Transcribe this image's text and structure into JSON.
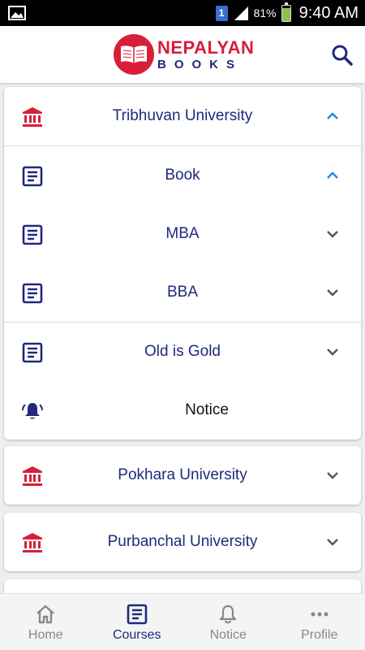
{
  "status_bar": {
    "sim_slot": "1",
    "battery": "81%",
    "time": "9:40 AM"
  },
  "header": {
    "logo_line1": "NEPALYAN",
    "logo_line2": "BOOKS"
  },
  "colors": {
    "brand_red": "#d71f3a",
    "brand_navy": "#1f2a7c",
    "accent_blue": "#1e88e5"
  },
  "universities": [
    {
      "name": "Tribhuvan University",
      "expanded": true,
      "children": [
        {
          "label": "Book",
          "expanded": true
        },
        {
          "label": "MBA",
          "expanded": false
        },
        {
          "label": "BBA",
          "expanded": false
        },
        {
          "label": "Old is Gold",
          "expanded": false
        },
        {
          "label": "Notice"
        }
      ]
    },
    {
      "name": "Pokhara University",
      "expanded": false
    },
    {
      "name": "Purbanchal University",
      "expanded": false
    }
  ],
  "bottom_nav": {
    "items": [
      {
        "label": "Home",
        "icon": "home-icon"
      },
      {
        "label": "Courses",
        "icon": "courses-icon",
        "active": true
      },
      {
        "label": "Notice",
        "icon": "bell-icon"
      },
      {
        "label": "Profile",
        "icon": "more-dots-icon"
      }
    ]
  }
}
